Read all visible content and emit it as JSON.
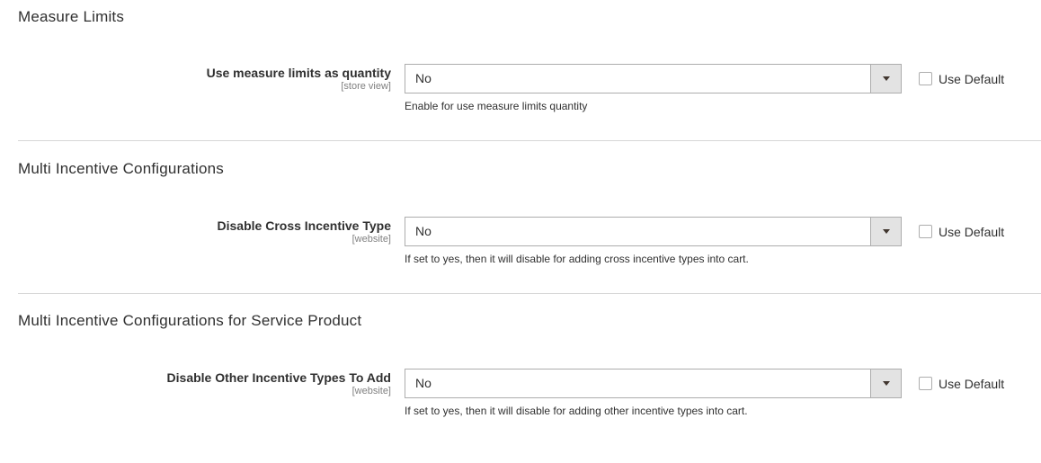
{
  "sections": [
    {
      "title": "Measure Limits",
      "field": {
        "label": "Use measure limits as quantity",
        "scope": "[store view]",
        "value": "No",
        "note": "Enable for use measure limits quantity",
        "use_default_label": "Use Default"
      }
    },
    {
      "title": "Multi Incentive Configurations",
      "field": {
        "label": "Disable Cross Incentive Type",
        "scope": "[website]",
        "value": "No",
        "note": "If set to yes, then it will disable for adding cross incentive types into cart.",
        "use_default_label": "Use Default"
      }
    },
    {
      "title": "Multi Incentive Configurations for Service Product",
      "field": {
        "label": "Disable Other Incentive Types To Add",
        "scope": "[website]",
        "value": "No",
        "note": "If set to yes, then it will disable for adding other incentive types into cart.",
        "use_default_label": "Use Default"
      }
    }
  ]
}
